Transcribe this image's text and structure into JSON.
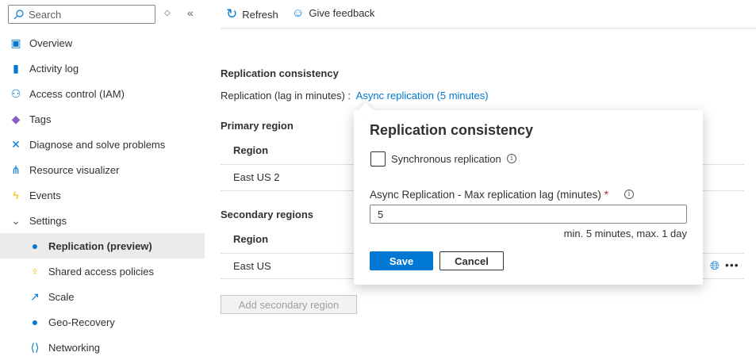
{
  "sidebar": {
    "search_placeholder": "Search",
    "items": [
      {
        "label": "Overview",
        "icon": "overview-icon"
      },
      {
        "label": "Activity log",
        "icon": "activity-log-icon"
      },
      {
        "label": "Access control (IAM)",
        "icon": "people-icon"
      },
      {
        "label": "Tags",
        "icon": "tag-icon"
      },
      {
        "label": "Diagnose and solve problems",
        "icon": "wrench-icon"
      },
      {
        "label": "Resource visualizer",
        "icon": "hierarchy-icon"
      },
      {
        "label": "Events",
        "icon": "lightning-icon"
      },
      {
        "label": "Settings",
        "icon": "chevron-down-icon"
      },
      {
        "label": "Replication (preview)",
        "icon": "globe-icon"
      },
      {
        "label": "Shared access policies",
        "icon": "key-icon"
      },
      {
        "label": "Scale",
        "icon": "scale-icon"
      },
      {
        "label": "Geo-Recovery",
        "icon": "globe-icon"
      },
      {
        "label": "Networking",
        "icon": "network-icon"
      }
    ]
  },
  "toolbar": {
    "refresh": "Refresh",
    "feedback": "Give feedback"
  },
  "main": {
    "consistency_title": "Replication consistency",
    "replication_label": "Replication (lag in minutes) :",
    "replication_link": "Async replication (5 minutes)",
    "primary_title": "Primary region",
    "secondary_title": "Secondary regions",
    "region_header": "Region",
    "primary_region": "East US 2",
    "secondary_region": "East US",
    "add_secondary": "Add secondary region"
  },
  "popup": {
    "title": "Replication consistency",
    "sync_label": "Synchronous replication",
    "lag_label": "Async Replication - Max replication lag (minutes)",
    "required": "*",
    "lag_value": "5",
    "hint": "min. 5 minutes, max. 1 day",
    "save": "Save",
    "cancel": "Cancel"
  },
  "colors": {
    "accent": "#0078d4",
    "selected": "#edebe9"
  }
}
